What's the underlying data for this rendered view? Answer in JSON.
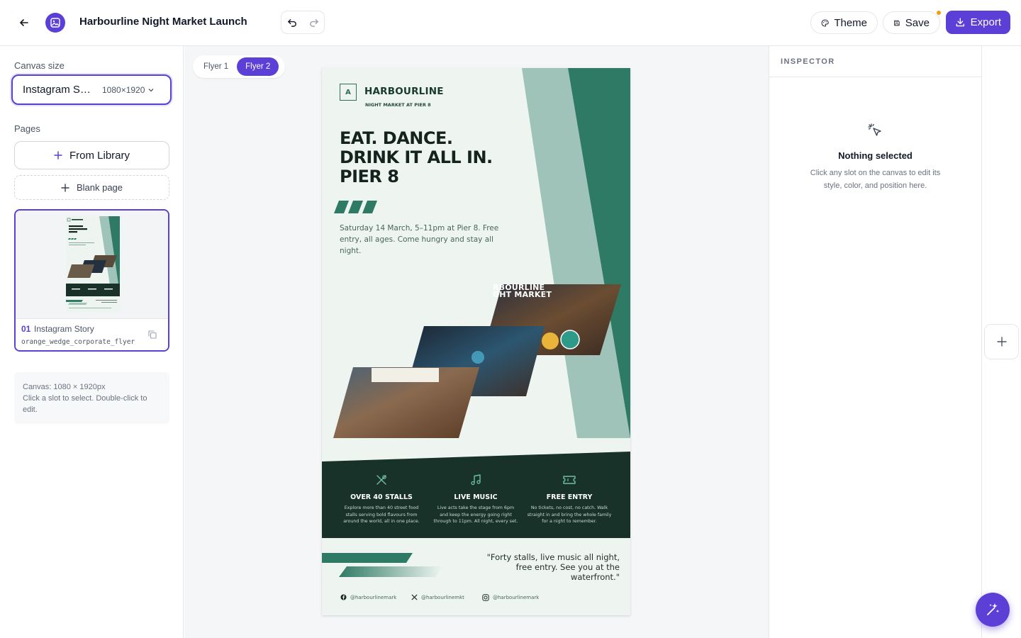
{
  "header": {
    "title": "Harbourline Night Market Launch",
    "theme_label": "Theme",
    "save_label": "Save",
    "export_label": "Export"
  },
  "left_panel": {
    "canvas_size_label": "Canvas size",
    "canvas_size_value": "Instagram Story",
    "canvas_size_dims": "1080×1920",
    "pages_label": "Pages",
    "from_library_label": "From Library",
    "blank_page_label": "Blank page",
    "pages": [
      {
        "number": "01",
        "name": "Instagram Story",
        "file": "orange_wedge_corporate_flyer"
      }
    ],
    "info_line1": "Canvas: 1080 × 1920px",
    "info_line2": "Click a slot to select. Double-click to edit."
  },
  "canvas": {
    "tabs": [
      {
        "label": "Flyer 1",
        "active": false
      },
      {
        "label": "Flyer 2",
        "active": true
      }
    ]
  },
  "flyer": {
    "brand_mark": "A",
    "brand_name": "HARBOURLINE",
    "brand_sub": "NIGHT MARKET AT PIER 8",
    "headline_lines": [
      "EAT. DANCE.",
      "DRINK IT ALL IN.",
      "PIER 8"
    ],
    "subcopy": "Saturday 14 March, 5–11pm at Pier 8. Free entry, all ages. Come hungry and stay all night.",
    "photo_overlay_line1": "RBOURLINE",
    "photo_overlay_line2": "GHT MARKET",
    "features": [
      {
        "icon": "utensils-icon",
        "title": "OVER 40 STALLS",
        "desc": "Explore more than 40 street food stalls serving bold flavours from around the world, all in one place."
      },
      {
        "icon": "music-note-icon",
        "title": "LIVE MUSIC",
        "desc": "Live acts take the stage from 6pm and keep the energy going right through to 11pm. All night, every set."
      },
      {
        "icon": "ticket-icon",
        "title": "FREE ENTRY",
        "desc": "No tickets, no cost, no catch. Walk straight in and bring the whole family for a night to remember."
      }
    ],
    "quote": "\"Forty stalls, live music all night, free entry. See you at the waterfront.\"",
    "socials": [
      {
        "icon": "facebook-icon",
        "handle": "@harbourlinemark"
      },
      {
        "icon": "x-icon",
        "handle": "@harbourlinemkt"
      },
      {
        "icon": "instagram-icon",
        "handle": "@harbourlinemark"
      }
    ],
    "colors": {
      "background": "#eef5f1",
      "accent_dark": "#2f7a64",
      "accent_light": "#9fc3b8",
      "band": "#183229"
    }
  },
  "inspector": {
    "title": "INSPECTOR",
    "empty_title": "Nothing selected",
    "empty_desc": "Click any slot on the canvas to edit its style, color, and position here."
  },
  "colors": {
    "primary": "#5b3fd6",
    "notification_dot": "#f59e0b"
  }
}
